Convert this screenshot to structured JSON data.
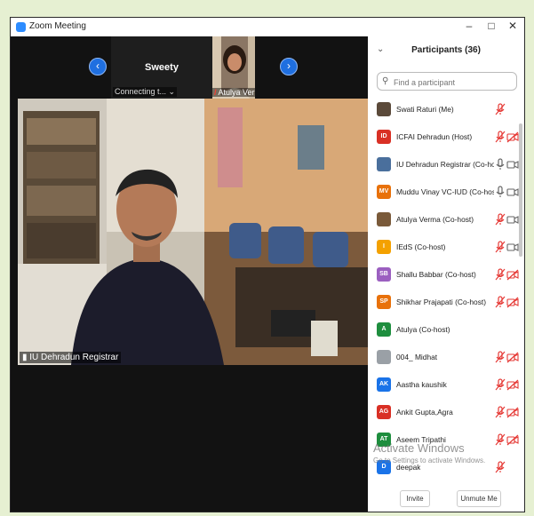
{
  "window": {
    "title": "Zoom Meeting",
    "minimize": "–",
    "maximize": "□",
    "close": "✕"
  },
  "strip": {
    "prev": "‹",
    "next": "›",
    "tiles": [
      {
        "name": "Sweety",
        "status": "Connecting t... ⌄"
      },
      {
        "name": "Atulya Verma"
      }
    ]
  },
  "main_video": {
    "caption": "IU Dehradun Registrar"
  },
  "panel": {
    "collapse": "⌄",
    "title": "Participants (36)",
    "search_placeholder": "Find a participant",
    "participants": [
      {
        "name": "Swati Raturi (Me)",
        "initials": "",
        "avatar_color": "#5b4a3a",
        "mic": "muted",
        "cam": "none"
      },
      {
        "name": "ICFAI Dehradun (Host)",
        "initials": "ID",
        "avatar_color": "#d93025",
        "mic": "muted",
        "cam": "off"
      },
      {
        "name": "IU Dehradun Registrar (Co-host)",
        "initials": "",
        "avatar_color": "#4a6f9c",
        "mic": "on",
        "cam": "on"
      },
      {
        "name": "Muddu Vinay VC-IUD (Co-host)",
        "initials": "MV",
        "avatar_color": "#e8710a",
        "mic": "on",
        "cam": "on"
      },
      {
        "name": "Atulya Verma (Co-host)",
        "initials": "",
        "avatar_color": "#7a5a3a",
        "mic": "muted",
        "cam": "on"
      },
      {
        "name": "IEdS (Co-host)",
        "initials": "I",
        "avatar_color": "#f4a100",
        "mic": "muted",
        "cam": "on"
      },
      {
        "name": "Shallu Babbar (Co-host)",
        "initials": "SB",
        "avatar_color": "#9b5fc0",
        "mic": "muted",
        "cam": "off"
      },
      {
        "name": "Shikhar Prajapati (Co-host)",
        "initials": "SP",
        "avatar_color": "#e8710a",
        "mic": "muted",
        "cam": "off"
      },
      {
        "name": "Atulya (Co-host)",
        "initials": "A",
        "avatar_color": "#1e8e3e",
        "mic": "none",
        "cam": "none"
      },
      {
        "name": "004_ Midhat",
        "initials": "",
        "avatar_color": "#9aa0a6",
        "mic": "muted",
        "cam": "off"
      },
      {
        "name": "Aastha kaushik",
        "initials": "AK",
        "avatar_color": "#1a73e8",
        "mic": "muted",
        "cam": "off"
      },
      {
        "name": "Ankit Gupta,Agra",
        "initials": "AG",
        "avatar_color": "#d93025",
        "mic": "muted",
        "cam": "off"
      },
      {
        "name": "Aseem Tripathi",
        "initials": "AT",
        "avatar_color": "#1e8e3e",
        "mic": "muted",
        "cam": "off"
      },
      {
        "name": "deepak",
        "initials": "D",
        "avatar_color": "#1a73e8",
        "mic": "muted",
        "cam": "none"
      }
    ],
    "footer": {
      "invite": "Invite",
      "unmute": "Unmute Me"
    }
  },
  "watermark": {
    "line1": "Activate Windows",
    "line2": "Go to Settings to activate Windows."
  }
}
